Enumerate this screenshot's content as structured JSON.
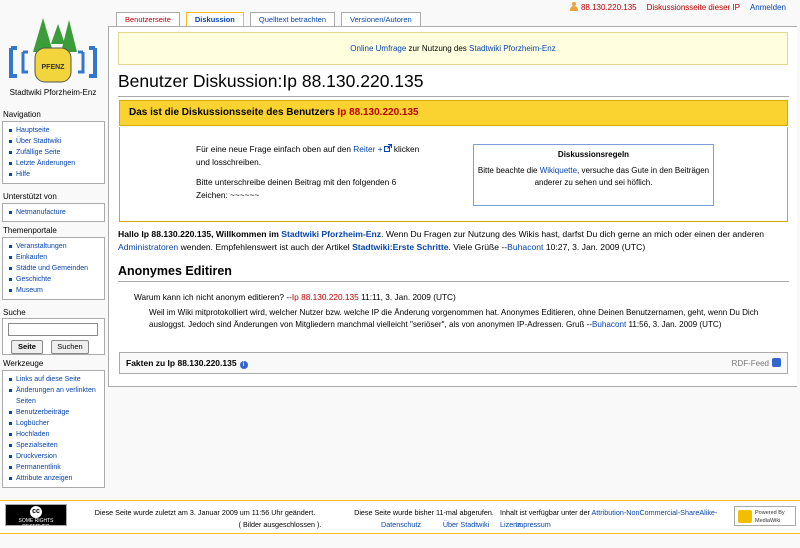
{
  "personal": {
    "user_ip": "88.130.220.135",
    "discussion": "Diskussionsseite dieser IP",
    "login": "Anmelden"
  },
  "logo": {
    "badge": "PFENZ",
    "name": "Stadtwiki Pforzheim-Enz"
  },
  "tabs": [
    {
      "label": "Benutzerseite"
    },
    {
      "label": "Diskussion"
    },
    {
      "label": "Quelltext betrachten"
    },
    {
      "label": "Versionen/Autoren"
    }
  ],
  "sitenotice": {
    "link": "Online Umfrage",
    "mid": " zur Nutzung des ",
    "link2": "Stadtwiki Pforzheim-Enz"
  },
  "title": "Benutzer Diskussion:Ip 88.130.220.135",
  "yellow_box": {
    "prefix": "Das ist die Diskussionsseite des Benutzers ",
    "user": "Ip 88.130.220.135"
  },
  "info": {
    "line1": "Für eine neue Frage einfach oben auf den ",
    "reiter": "Reiter +",
    "line1b": " klicken und losschreiben.",
    "line2": "Bitte unterschreibe deinen Beitrag mit den folgenden 6 Zeichen: ~~~~~~"
  },
  "rules": {
    "title": "Diskussionsregeln",
    "pre": "Bitte beachte die ",
    "link": "Wikiquette",
    "post": ", versuche das Gute in den Beiträgen anderer zu sehen und sei höflich."
  },
  "hallo": {
    "b1": "Hallo Ip 88.130.220.135, Willkommen im ",
    "site": "Stadtwiki Pforzheim-Enz",
    "t1": ". Wenn Du Fragen zur Nutzung des Wikis hast, darfst Du dich gerne an mich oder einen der anderen ",
    "admins": "Administratoren",
    "t2": " wenden. Empfehlenswert ist auch der Artikel ",
    "article": "Stadtwiki:Erste Schritte",
    "t3": ". Viele Grüße --",
    "user": "Buhacont",
    "t4": " 10:27, 3. Jan. 2009 (UTC)"
  },
  "section_heading": "Anonymes Editiren",
  "question": {
    "text": "Warum kann ich nicht anonym editieren? --",
    "ip": "Ip 88.130.220.135",
    "time": " 11:11, 3. Jan. 2009 (UTC)"
  },
  "answer": {
    "text": "Weil im Wiki mitprotokolliert wird, welcher Nutzer bzw. welche IP die Änderung vorgenommen hat. Anonymes Editieren, ohne Deinen Benutzernamen, geht, wenn Du Dich ausloggst. Jedoch sind Änderungen von Mitgliedern manchmal vielleicht \"seriöser\", als von anonymen IP-Adressen. Gruß --",
    "user": "Buhacont",
    "time": " 11:56, 3. Jan. 2009 (UTC)"
  },
  "facts": {
    "title": "Fakten zu Ip 88.130.220.135",
    "info_icon": "i",
    "rdf": "RDF-Feed"
  },
  "sidebar": {
    "navigation": {
      "heading": "Navigation",
      "items": [
        "Hauptseite",
        "Über Stadtwiki",
        "Zufällige Seite",
        "Letzte Änderungen",
        "Hilfe"
      ]
    },
    "supported": {
      "heading": "Unterstützt von",
      "items": [
        "Netmanufacture"
      ]
    },
    "portals": {
      "heading": "Themenportale",
      "items": [
        "Veranstaltungen",
        "Einkaufen",
        "Städte und Gemeinden",
        "Geschichte",
        "Museum"
      ]
    },
    "search": {
      "heading": "Suche",
      "go": "Seite",
      "search": "Suchen"
    },
    "tools": {
      "heading": "Werkzeuge",
      "items": [
        "Links auf diese Seite",
        "Änderungen an verlinkten Seiten",
        "Benutzerbeiträge",
        "Logbücher",
        "Hochladen",
        "Spezialseiten",
        "Druckversion",
        "Permanentlink",
        "Attribute anzeigen"
      ]
    }
  },
  "footer": {
    "cc_badge": "SOME RIGHTS RESERVED",
    "cc_letter": "cc",
    "lastmod": "Diese Seite wurde zuletzt am 3. Januar 2009 um 11:56 Uhr geändert.",
    "views": "Diese Seite wurde bisher 11-mal abgerufen.",
    "license_pre": "Inhalt ist verfügbar unter der ",
    "license_link": "Attribution-NonCommercial-ShareAlike-Lizenz.",
    "license_post": " ( Bilder ausgeschlossen ).",
    "privacy": "Datenschutz",
    "about": "Über Stadtwiki",
    "imprint": "Impressum",
    "powered": "Powered By MediaWiki"
  },
  "colors": {
    "link": "#0645ad",
    "new_link": "#ba0000",
    "highlight": "#fbd330"
  }
}
